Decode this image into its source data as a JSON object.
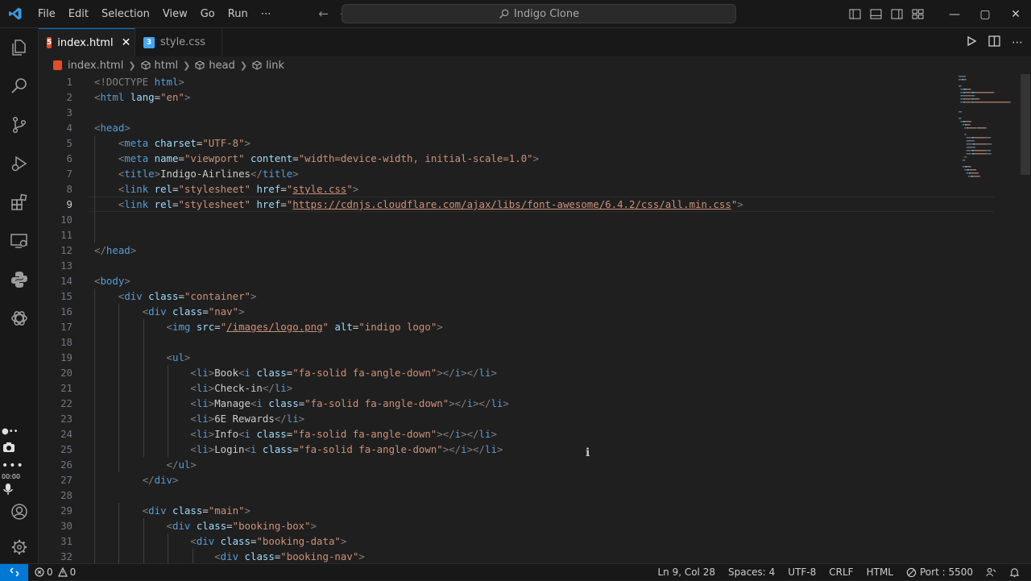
{
  "titlebar": {
    "menu": [
      "File",
      "Edit",
      "Selection",
      "View",
      "Go",
      "Run",
      "⋯"
    ],
    "search_label": "Indigo Clone",
    "window_controls": {
      "minimize": "—",
      "maximize": "▢",
      "close": "✕"
    }
  },
  "tabs": [
    {
      "label": "index.html",
      "type": "html",
      "active": true,
      "close": "✕"
    },
    {
      "label": "style.css",
      "type": "css",
      "active": false
    }
  ],
  "breadcrumb": [
    "index.html",
    "html",
    "head",
    "link"
  ],
  "editor": {
    "current_line": 9,
    "lines": [
      [
        [
          "pu",
          "<!DOCTYPE "
        ],
        [
          "tg",
          "html"
        ],
        [
          "pu",
          ">"
        ]
      ],
      [
        [
          "pu",
          "<"
        ],
        [
          "tg",
          "html"
        ],
        [
          "at",
          " lang"
        ],
        [
          "tx",
          "="
        ],
        [
          "st",
          "\"en\""
        ],
        [
          "pu",
          ">"
        ]
      ],
      [],
      [
        [
          "pu",
          "<"
        ],
        [
          "tg",
          "head"
        ],
        [
          "pu",
          ">"
        ]
      ],
      [
        [
          "tx",
          "    "
        ],
        [
          "pu",
          "<"
        ],
        [
          "tg",
          "meta"
        ],
        [
          "at",
          " charset"
        ],
        [
          "tx",
          "="
        ],
        [
          "st",
          "\"UTF-8\""
        ],
        [
          "pu",
          ">"
        ]
      ],
      [
        [
          "tx",
          "    "
        ],
        [
          "pu",
          "<"
        ],
        [
          "tg",
          "meta"
        ],
        [
          "at",
          " name"
        ],
        [
          "tx",
          "="
        ],
        [
          "st",
          "\"viewport\""
        ],
        [
          "at",
          " content"
        ],
        [
          "tx",
          "="
        ],
        [
          "st",
          "\"width=device-width, initial-scale=1.0\""
        ],
        [
          "pu",
          ">"
        ]
      ],
      [
        [
          "tx",
          "    "
        ],
        [
          "pu",
          "<"
        ],
        [
          "tg",
          "title"
        ],
        [
          "pu",
          ">"
        ],
        [
          "tx",
          "Indigo-Airlines"
        ],
        [
          "pu",
          "</"
        ],
        [
          "tg",
          "title"
        ],
        [
          "pu",
          ">"
        ]
      ],
      [
        [
          "tx",
          "    "
        ],
        [
          "pu",
          "<"
        ],
        [
          "tg",
          "link"
        ],
        [
          "at",
          " rel"
        ],
        [
          "tx",
          "="
        ],
        [
          "st",
          "\"stylesheet\""
        ],
        [
          "at",
          " href"
        ],
        [
          "tx",
          "="
        ],
        [
          "st",
          "\""
        ],
        [
          "lk",
          "style.css"
        ],
        [
          "st",
          "\""
        ],
        [
          "pu",
          ">"
        ]
      ],
      [
        [
          "tx",
          "    "
        ],
        [
          "pu",
          "<"
        ],
        [
          "tg",
          "link"
        ],
        [
          "at",
          " rel"
        ],
        [
          "tx",
          "="
        ],
        [
          "st",
          "\"stylesheet\""
        ],
        [
          "at",
          " href"
        ],
        [
          "tx",
          "="
        ],
        [
          "st",
          "\""
        ],
        [
          "lk",
          "https://cdnjs.cloudflare.com/ajax/libs/font-awesome/6.4.2/css/all.min.css"
        ],
        [
          "st",
          "\""
        ],
        [
          "pu",
          ">"
        ]
      ],
      [],
      [],
      [
        [
          "pu",
          "</"
        ],
        [
          "tg",
          "head"
        ],
        [
          "pu",
          ">"
        ]
      ],
      [],
      [
        [
          "pu",
          "<"
        ],
        [
          "tg",
          "body"
        ],
        [
          "pu",
          ">"
        ]
      ],
      [
        [
          "tx",
          "    "
        ],
        [
          "pu",
          "<"
        ],
        [
          "tg",
          "div"
        ],
        [
          "at",
          " class"
        ],
        [
          "tx",
          "="
        ],
        [
          "st",
          "\"container\""
        ],
        [
          "pu",
          ">"
        ]
      ],
      [
        [
          "tx",
          "        "
        ],
        [
          "pu",
          "<"
        ],
        [
          "tg",
          "div"
        ],
        [
          "at",
          " class"
        ],
        [
          "tx",
          "="
        ],
        [
          "st",
          "\"nav\""
        ],
        [
          "pu",
          ">"
        ]
      ],
      [
        [
          "tx",
          "            "
        ],
        [
          "pu",
          "<"
        ],
        [
          "tg",
          "img"
        ],
        [
          "at",
          " src"
        ],
        [
          "tx",
          "="
        ],
        [
          "st",
          "\""
        ],
        [
          "lk",
          "/images/logo.png"
        ],
        [
          "st",
          "\""
        ],
        [
          "at",
          " alt"
        ],
        [
          "tx",
          "="
        ],
        [
          "st",
          "\"indigo logo\""
        ],
        [
          "pu",
          ">"
        ]
      ],
      [],
      [
        [
          "tx",
          "            "
        ],
        [
          "pu",
          "<"
        ],
        [
          "tg",
          "ul"
        ],
        [
          "pu",
          ">"
        ]
      ],
      [
        [
          "tx",
          "                "
        ],
        [
          "pu",
          "<"
        ],
        [
          "tg",
          "li"
        ],
        [
          "pu",
          ">"
        ],
        [
          "tx",
          "Book"
        ],
        [
          "pu",
          "<"
        ],
        [
          "tg",
          "i"
        ],
        [
          "at",
          " class"
        ],
        [
          "tx",
          "="
        ],
        [
          "st",
          "\"fa-solid fa-angle-down\""
        ],
        [
          "pu",
          "></"
        ],
        [
          "tg",
          "i"
        ],
        [
          "pu",
          "></"
        ],
        [
          "tg",
          "li"
        ],
        [
          "pu",
          ">"
        ]
      ],
      [
        [
          "tx",
          "                "
        ],
        [
          "pu",
          "<"
        ],
        [
          "tg",
          "li"
        ],
        [
          "pu",
          ">"
        ],
        [
          "tx",
          "Check-in"
        ],
        [
          "pu",
          "</"
        ],
        [
          "tg",
          "li"
        ],
        [
          "pu",
          ">"
        ]
      ],
      [
        [
          "tx",
          "                "
        ],
        [
          "pu",
          "<"
        ],
        [
          "tg",
          "li"
        ],
        [
          "pu",
          ">"
        ],
        [
          "tx",
          "Manage"
        ],
        [
          "pu",
          "<"
        ],
        [
          "tg",
          "i"
        ],
        [
          "at",
          " class"
        ],
        [
          "tx",
          "="
        ],
        [
          "st",
          "\"fa-solid fa-angle-down\""
        ],
        [
          "pu",
          "></"
        ],
        [
          "tg",
          "i"
        ],
        [
          "pu",
          "></"
        ],
        [
          "tg",
          "li"
        ],
        [
          "pu",
          ">"
        ]
      ],
      [
        [
          "tx",
          "                "
        ],
        [
          "pu",
          "<"
        ],
        [
          "tg",
          "li"
        ],
        [
          "pu",
          ">"
        ],
        [
          "tx",
          "6E Rewards"
        ],
        [
          "pu",
          "</"
        ],
        [
          "tg",
          "li"
        ],
        [
          "pu",
          ">"
        ]
      ],
      [
        [
          "tx",
          "                "
        ],
        [
          "pu",
          "<"
        ],
        [
          "tg",
          "li"
        ],
        [
          "pu",
          ">"
        ],
        [
          "tx",
          "Info"
        ],
        [
          "pu",
          "<"
        ],
        [
          "tg",
          "i"
        ],
        [
          "at",
          " class"
        ],
        [
          "tx",
          "="
        ],
        [
          "st",
          "\"fa-solid fa-angle-down\""
        ],
        [
          "pu",
          "></"
        ],
        [
          "tg",
          "i"
        ],
        [
          "pu",
          "></"
        ],
        [
          "tg",
          "li"
        ],
        [
          "pu",
          ">"
        ]
      ],
      [
        [
          "tx",
          "                "
        ],
        [
          "pu",
          "<"
        ],
        [
          "tg",
          "li"
        ],
        [
          "pu",
          ">"
        ],
        [
          "tx",
          "Login"
        ],
        [
          "pu",
          "<"
        ],
        [
          "tg",
          "i"
        ],
        [
          "at",
          " class"
        ],
        [
          "tx",
          "="
        ],
        [
          "st",
          "\"fa-solid fa-angle-down\""
        ],
        [
          "pu",
          "></"
        ],
        [
          "tg",
          "i"
        ],
        [
          "pu",
          "></"
        ],
        [
          "tg",
          "li"
        ],
        [
          "pu",
          ">"
        ]
      ],
      [
        [
          "tx",
          "            "
        ],
        [
          "pu",
          "</"
        ],
        [
          "tg",
          "ul"
        ],
        [
          "pu",
          ">"
        ]
      ],
      [
        [
          "tx",
          "        "
        ],
        [
          "pu",
          "</"
        ],
        [
          "tg",
          "div"
        ],
        [
          "pu",
          ">"
        ]
      ],
      [],
      [
        [
          "tx",
          "        "
        ],
        [
          "pu",
          "<"
        ],
        [
          "tg",
          "div"
        ],
        [
          "at",
          " class"
        ],
        [
          "tx",
          "="
        ],
        [
          "st",
          "\"main\""
        ],
        [
          "pu",
          ">"
        ]
      ],
      [
        [
          "tx",
          "            "
        ],
        [
          "pu",
          "<"
        ],
        [
          "tg",
          "div"
        ],
        [
          "at",
          " class"
        ],
        [
          "tx",
          "="
        ],
        [
          "st",
          "\"booking-box\""
        ],
        [
          "pu",
          ">"
        ]
      ],
      [
        [
          "tx",
          "                "
        ],
        [
          "pu",
          "<"
        ],
        [
          "tg",
          "div"
        ],
        [
          "at",
          " class"
        ],
        [
          "tx",
          "="
        ],
        [
          "st",
          "\"booking-data\""
        ],
        [
          "pu",
          ">"
        ]
      ],
      [
        [
          "tx",
          "                    "
        ],
        [
          "pu",
          "<"
        ],
        [
          "tg",
          "div"
        ],
        [
          "at",
          " class"
        ],
        [
          "tx",
          "="
        ],
        [
          "st",
          "\"booking-nav\""
        ],
        [
          "pu",
          ">"
        ]
      ]
    ]
  },
  "statusbar": {
    "errors": "0",
    "warnings": "0",
    "position": "Ln 9, Col 28",
    "spaces": "Spaces: 4",
    "encoding": "UTF-8",
    "eol": "CRLF",
    "language": "HTML",
    "port": "Port : 5500"
  },
  "overlay": {
    "timer": "00:00"
  },
  "colors": {
    "accent": "#0078d4",
    "html_icon": "#e44d26",
    "css_icon": "#42a5f5",
    "vscode_logo": "#3b9ae1"
  }
}
